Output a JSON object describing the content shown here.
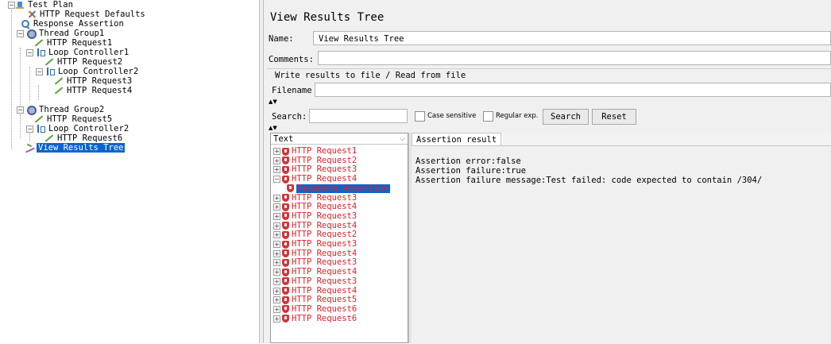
{
  "test_plan_tree": {
    "nodes": [
      {
        "label": "Test Plan",
        "icon": "test-plan-icon"
      },
      {
        "label": "HTTP Request Defaults",
        "icon": "config-element-icon"
      },
      {
        "label": "Response Assertion",
        "icon": "assertion-icon"
      },
      {
        "label": "Thread Group1",
        "icon": "thread-group-icon"
      },
      {
        "label": "HTTP Request1",
        "icon": "http-sampler-icon"
      },
      {
        "label": "Loop Controller1",
        "icon": "loop-controller-icon"
      },
      {
        "label": "HTTP Request2",
        "icon": "http-sampler-icon"
      },
      {
        "label": "Loop Controller2",
        "icon": "loop-controller-icon"
      },
      {
        "label": "HTTP Request3",
        "icon": "http-sampler-icon"
      },
      {
        "label": "HTTP Request4",
        "icon": "http-sampler-icon"
      },
      {
        "label": "Thread Group2",
        "icon": "thread-group-icon"
      },
      {
        "label": "HTTP Request5",
        "icon": "http-sampler-icon"
      },
      {
        "label": "Loop Controller2",
        "icon": "loop-controller-icon"
      },
      {
        "label": "HTTP Request6",
        "icon": "http-sampler-icon"
      },
      {
        "label": "View Results Tree",
        "icon": "listener-icon",
        "selected": true
      }
    ]
  },
  "panel": {
    "title": "View Results Tree",
    "name_label": "Name:",
    "name_value": "View Results Tree",
    "comments_label": "Comments:",
    "comments_value": "",
    "file_section_title": "Write results to file / Read from file",
    "filename_label": "Filename",
    "filename_value": "",
    "search_label": "Search:",
    "search_value": "",
    "case_sensitive_label": "Case sensitive",
    "regular_exp_label": "Regular exp.",
    "search_button": "Search",
    "reset_button": "Reset"
  },
  "results_list": {
    "renderer": "Text",
    "rows": [
      {
        "label": "HTTP Request1",
        "expanded": false
      },
      {
        "label": "HTTP Request2",
        "expanded": false
      },
      {
        "label": "HTTP Request3",
        "expanded": false
      },
      {
        "label": "HTTP Request4",
        "expanded": true
      },
      {
        "label": "Response Assertion",
        "child": true,
        "selected": true
      },
      {
        "label": "HTTP Request3",
        "expanded": false
      },
      {
        "label": "HTTP Request4",
        "expanded": false
      },
      {
        "label": "HTTP Request3",
        "expanded": false
      },
      {
        "label": "HTTP Request4",
        "expanded": false
      },
      {
        "label": "HTTP Request2",
        "expanded": false
      },
      {
        "label": "HTTP Request3",
        "expanded": false
      },
      {
        "label": "HTTP Request4",
        "expanded": false
      },
      {
        "label": "HTTP Request3",
        "expanded": false
      },
      {
        "label": "HTTP Request4",
        "expanded": false
      },
      {
        "label": "HTTP Request3",
        "expanded": false
      },
      {
        "label": "HTTP Request4",
        "expanded": false
      },
      {
        "label": "HTTP Request5",
        "expanded": false
      },
      {
        "label": "HTTP Request6",
        "expanded": false
      },
      {
        "label": "HTTP Request6",
        "expanded": false
      }
    ]
  },
  "detail": {
    "tab_label": "Assertion result",
    "lines": [
      "Assertion error:false",
      "Assertion failure:true",
      "Assertion failure message:Test failed: code expected to contain /304/"
    ]
  },
  "colors": {
    "selection": "#0a64d0",
    "failed_text": "#e0202a",
    "panel_background": "#f0f0f0"
  }
}
